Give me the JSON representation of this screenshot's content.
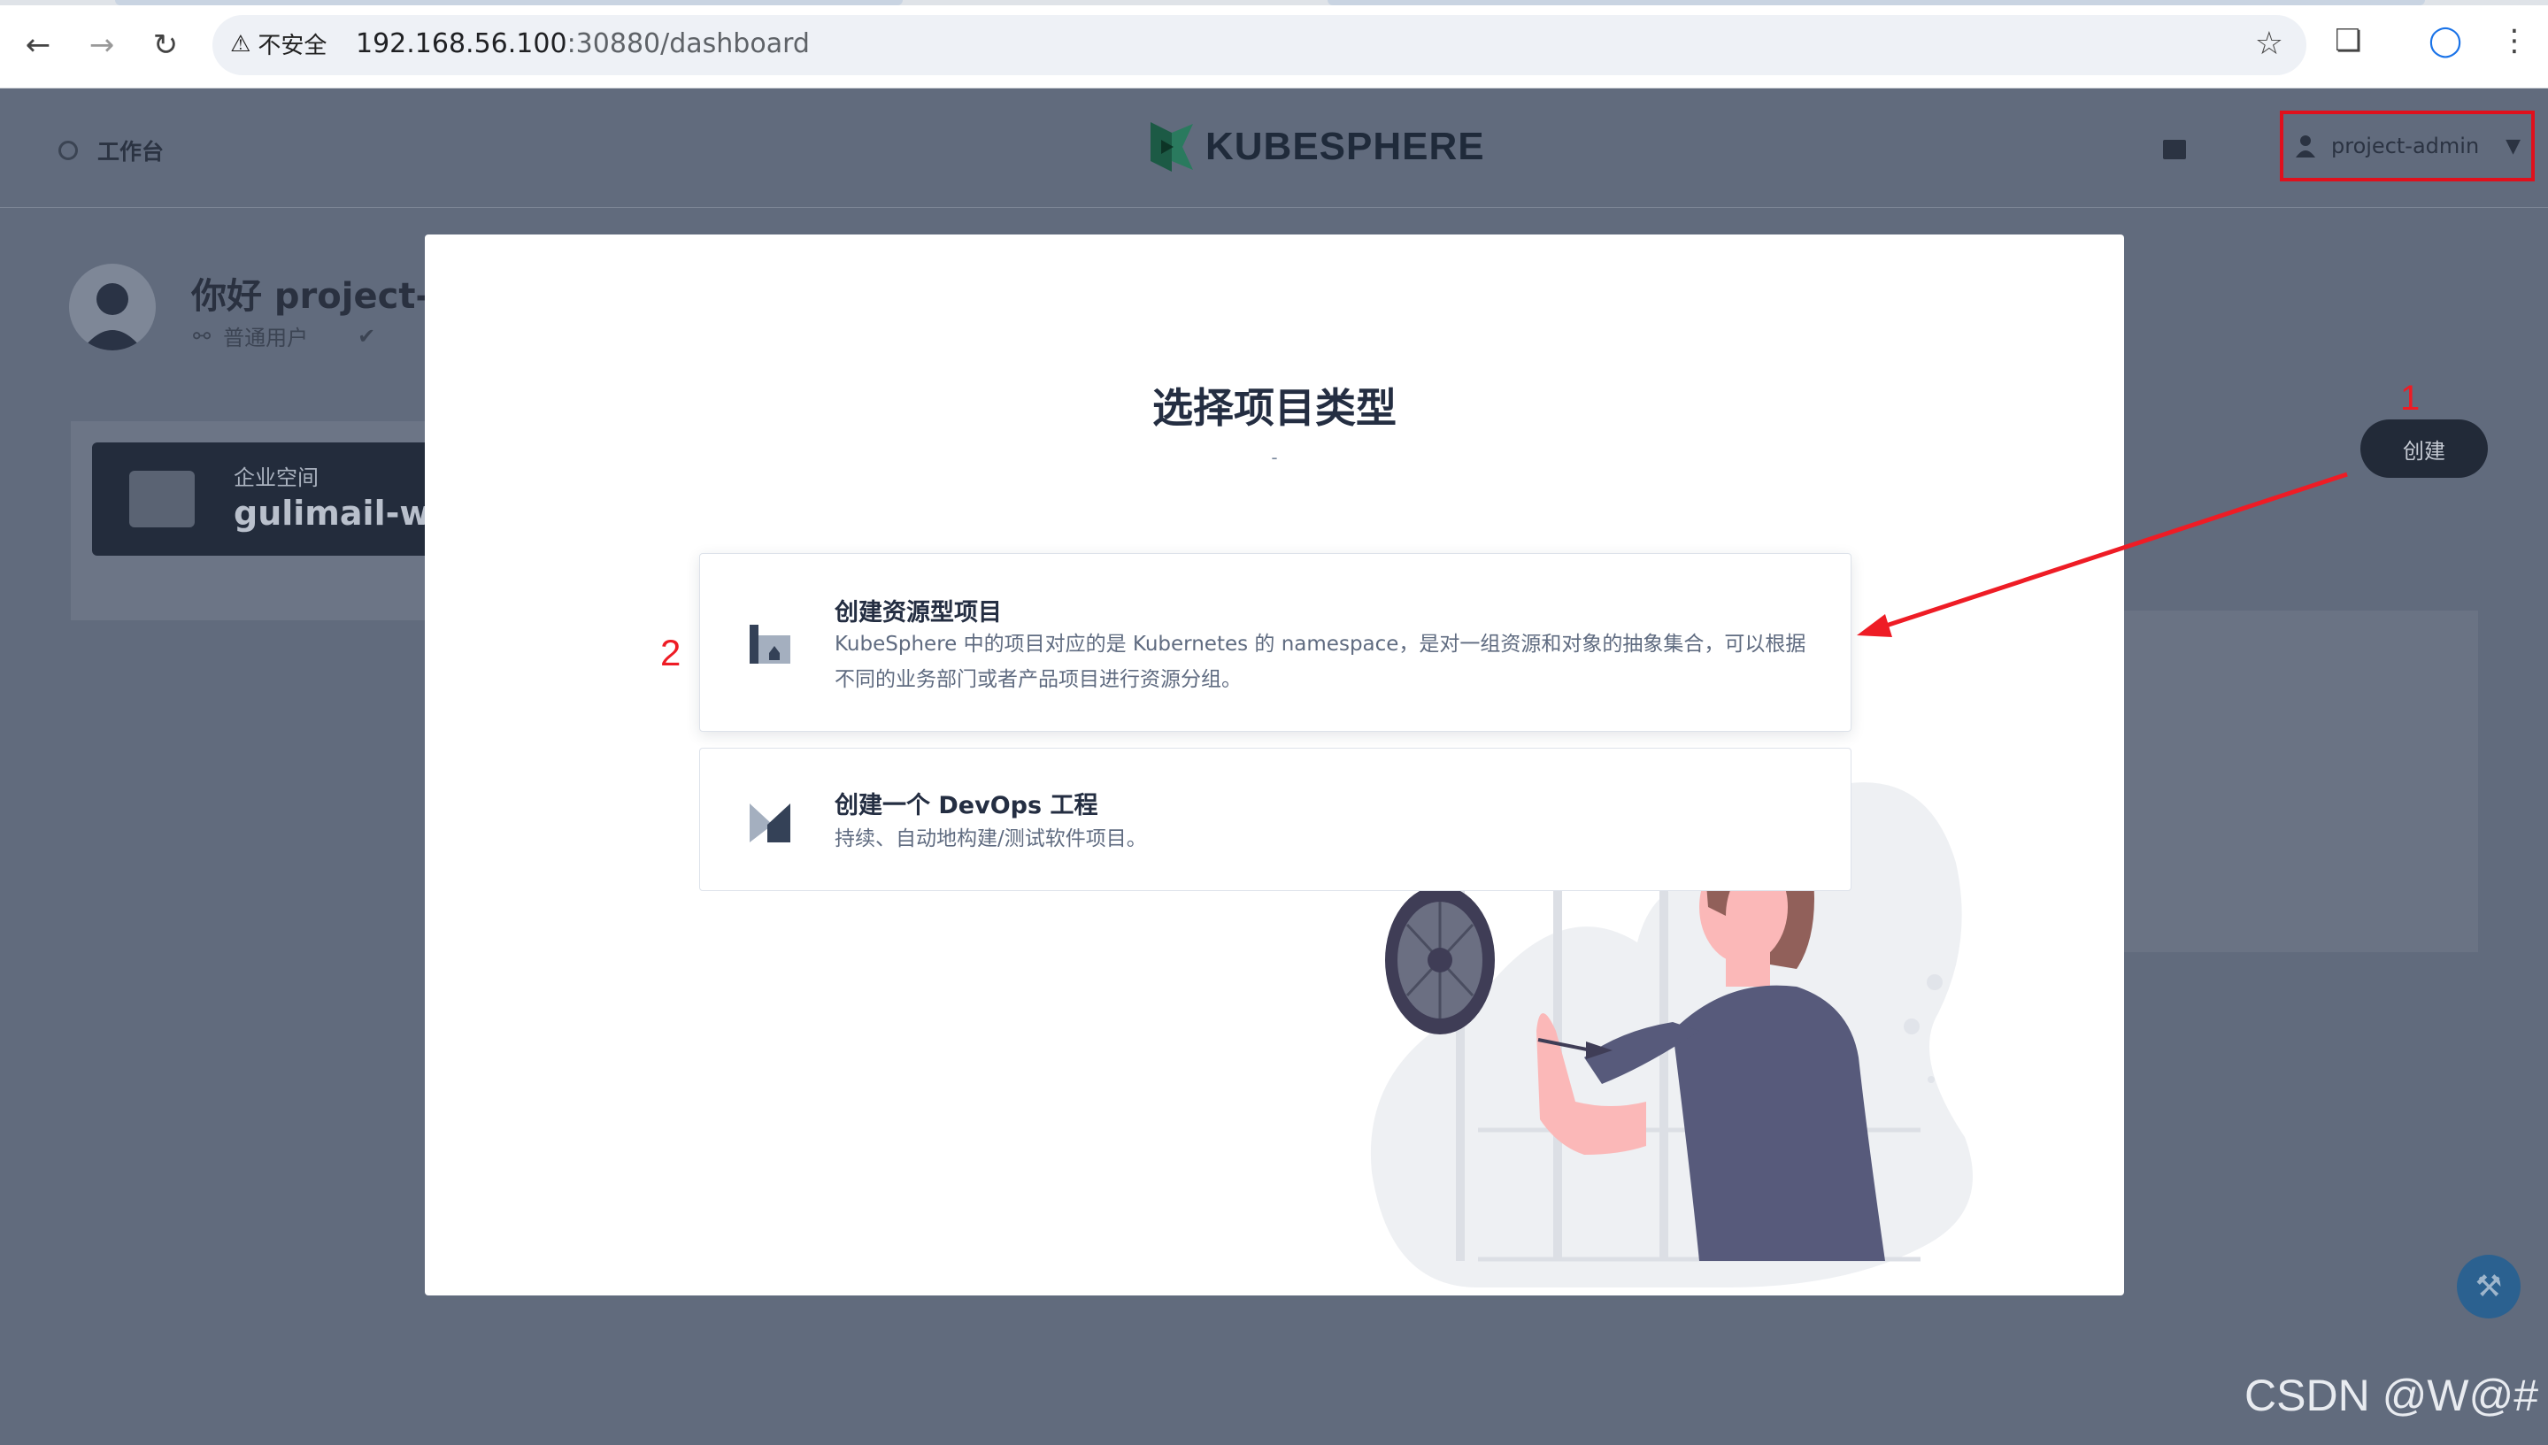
{
  "browser": {
    "warning_label": "不安全",
    "url_host": "192.168.56.100",
    "url_path": ":30880/dashboard"
  },
  "header": {
    "workbench_label": "工作台",
    "logo_text": "KUBESPHERE",
    "user_name": "project-admin"
  },
  "dashboard": {
    "greeting": "你好 project-a",
    "role": "普通用户",
    "workspace_label": "企业空间",
    "workspace_name": "gulimail-wo",
    "create_button": "创建"
  },
  "modal": {
    "title": "选择项目类型",
    "subtitle": "-",
    "options": [
      {
        "title": "创建资源型项目",
        "description": "KubeSphere 中的项目对应的是 Kubernetes 的 namespace，是对一组资源和对象的抽象集合，可以根据不同的业务部门或者产品项目进行资源分组。",
        "icon": "project-icon"
      },
      {
        "title": "创建一个 DevOps 工程",
        "description": "持续、自动地构建/测试软件项目。",
        "icon": "devops-icon"
      }
    ]
  },
  "annotations": {
    "step1": "1",
    "step2": "2",
    "color": "#ee1c25"
  },
  "watermark": "CSDN @W@#"
}
